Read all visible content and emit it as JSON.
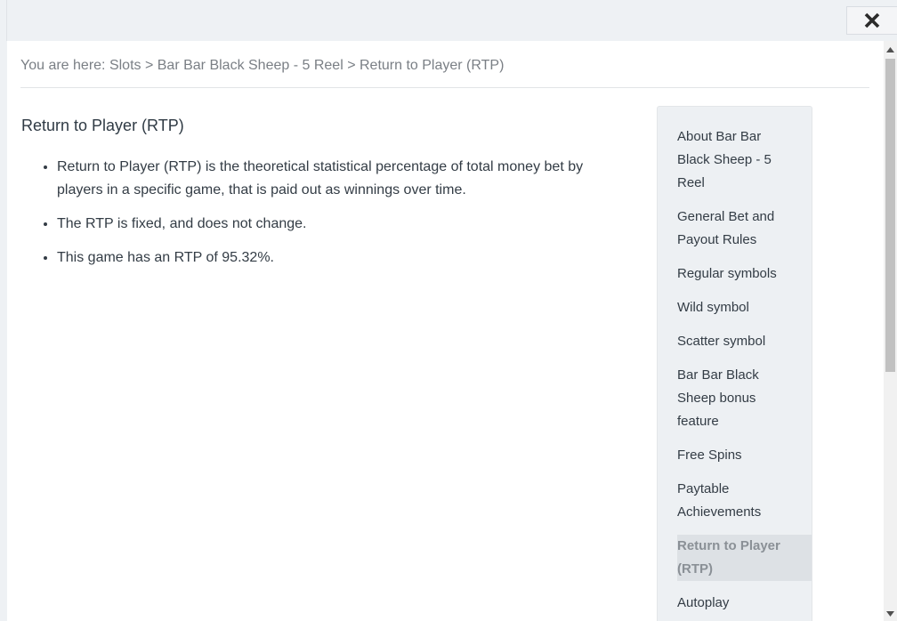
{
  "window": {
    "close_icon": "close-icon"
  },
  "breadcrumb": {
    "prefix": "You are here: ",
    "items": [
      "Slots",
      "Bar Bar Black Sheep - 5 Reel",
      "Return to Player (RTP)"
    ],
    "separator": " > "
  },
  "content": {
    "title": "Return to Player (RTP)",
    "bullets": [
      "Return to Player (RTP) is the theoretical statistical percentage of total money bet by players in a specific game, that is paid out as winnings over time.",
      "The RTP is fixed, and does not change.",
      "This game has an RTP of 95.32%."
    ]
  },
  "toc": {
    "items": [
      "About Bar Bar Black Sheep - 5 Reel",
      "General Bet and Payout Rules",
      "Regular symbols",
      "Wild symbol",
      "Scatter symbol",
      "Bar Bar Black Sheep bonus feature",
      "Free Spins",
      "Paytable Achievements",
      "Return to Player (RTP)",
      "Autoplay"
    ],
    "active_index": 8
  },
  "colors": {
    "background": "#eef1f4",
    "panel": "#ffffff",
    "text": "#333c45",
    "muted": "#7a7f85"
  }
}
